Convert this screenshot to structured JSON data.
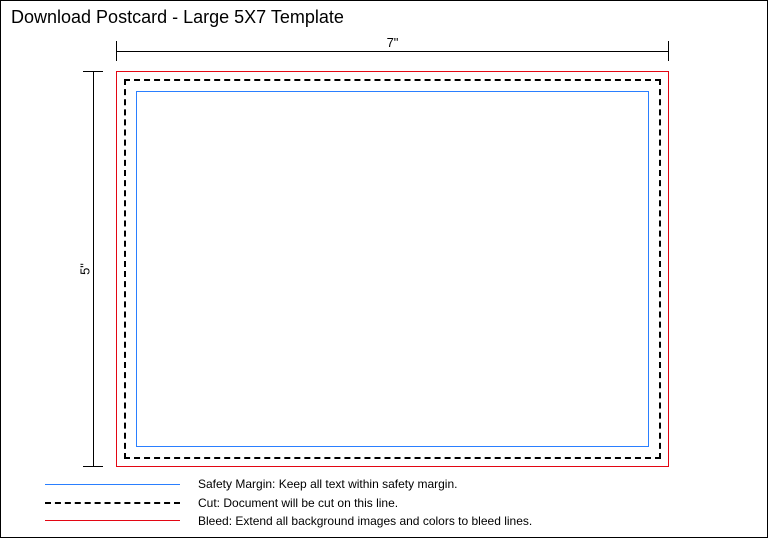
{
  "title": "Download Postcard - Large 5X7 Template",
  "dimensions": {
    "width_label": "7\"",
    "height_label": "5\""
  },
  "legend": {
    "safety": {
      "lead": "Safety Margin:",
      "desc": " Keep all text within safety margin."
    },
    "cut": {
      "lead": "Cut:",
      "desc": " Document will be cut on this line."
    },
    "bleed": {
      "lead": "Bleed:",
      "desc": " Extend all background images and colors to bleed lines."
    }
  }
}
